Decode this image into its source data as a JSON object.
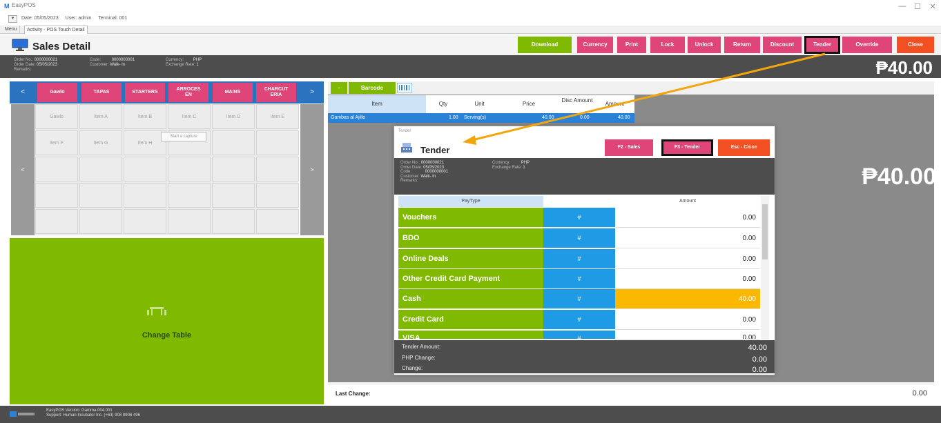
{
  "app": {
    "title": "EasyPOS",
    "logo_text": "M",
    "status": {
      "date": "Date: 05/05/2023",
      "user": "User: admin",
      "terminal": "Terminal: 001"
    },
    "window_controls": {
      "minimize": "—",
      "maximize": "☐",
      "close": "✕"
    }
  },
  "tabs": [
    {
      "label": "Menu"
    },
    {
      "label": "Activity - POS Touch Detail"
    }
  ],
  "header": {
    "title": "Sales Detail",
    "buttons": {
      "download": "Download",
      "currency": "Currency",
      "print": "Print",
      "lock": "Lock",
      "unlock": "Unlock",
      "return": "Return",
      "discount": "Discount",
      "tender": "Tender",
      "override": "Override",
      "close": "Close"
    }
  },
  "order_info": {
    "order_no_label": "Order No.:",
    "order_no": "0000000021",
    "order_date_label": "Order Date:",
    "order_date": "05/05/2023",
    "remarks_label": "Remarks:",
    "code_label": "Code:",
    "code": "0000000001",
    "customer_label": "Customer:",
    "customer": "Walk- In",
    "currency_label": "Currency:",
    "currency": "PHP",
    "exchange_rate_label": "Exchange Rate:",
    "exchange_rate": "1",
    "total": "₱40.00"
  },
  "categories": {
    "prev": "<",
    "next": ">",
    "items": [
      "Gawlo",
      "TAPAS",
      "STARTERS",
      "ARROCES EN",
      "MAINS",
      "CHARCUT ERIA"
    ]
  },
  "item_grid": {
    "left_arrow": "<",
    "right_arrow": ">",
    "row1": [
      "Gawlo",
      "Item A",
      "Item B",
      "Item C",
      "Item D",
      "Item E"
    ],
    "row2": [
      "Item F",
      "Item G",
      "Item H",
      "",
      "",
      ""
    ],
    "tooltip": "Start a capture"
  },
  "change_table": {
    "label": "Change Table"
  },
  "order_lines": {
    "minus": "-",
    "barcode_label": "Barcode",
    "columns": [
      "Item",
      "Qty",
      "Unit",
      "Price",
      "Disc Amount",
      "Amount"
    ],
    "rows": [
      {
        "item": "Gambas al Ajillo",
        "qty": "1.00",
        "unit": "Serving(s)",
        "price": "40.00",
        "disc": "0.00",
        "amount": "40.00"
      }
    ]
  },
  "tender_dialog": {
    "window_title": "Tender",
    "title": "Tender",
    "buttons": {
      "sales": "F2 - Sales",
      "tender": "F3 - Tender",
      "close": "Esc - Close"
    },
    "info": {
      "order_no_label": "Order No.:",
      "order_no": "0000000021",
      "order_date_label": "Order Date:",
      "order_date": "05/05/2023",
      "code_label": "Code:",
      "code": "0000000001",
      "customer_label": "Customer:",
      "customer": "Walk- In",
      "remarks_label": "Remarks:",
      "currency_label": "Currency:",
      "currency": "PHP",
      "exchange_rate_label": "Exchange Rate:",
      "exchange_rate": "1"
    },
    "total": "₱40.00",
    "pay_columns": [
      "PayType",
      "",
      "Amount"
    ],
    "pay_types": [
      {
        "name": "Vouchers",
        "hash": "#",
        "amount": "0.00"
      },
      {
        "name": "BDO",
        "hash": "#",
        "amount": "0.00"
      },
      {
        "name": "Online Deals",
        "hash": "#",
        "amount": "0.00"
      },
      {
        "name": "Other Credit Card Payment",
        "hash": "#",
        "amount": "0.00"
      },
      {
        "name": "Cash",
        "hash": "#",
        "amount": "40.00"
      },
      {
        "name": "Credit Card",
        "hash": "#",
        "amount": "0.00"
      },
      {
        "name": "VISA",
        "hash": "#",
        "amount": "0.00"
      }
    ],
    "summary": {
      "tender_amount_label": "Tender Amount:",
      "tender_amount": "40.00",
      "php_change_label": "PHP Change:",
      "php_change": "0.00",
      "change_label": "Change:",
      "change": "0.00"
    }
  },
  "last_change": {
    "label": "Last Change:",
    "value": "0.00"
  },
  "footer": {
    "logo_text": "EasyPOS",
    "version": "EasyPOS Version: Gamma.004.001",
    "support": "Support: Human Incubator Inc. (+63) 908 8906 496"
  },
  "colors": {
    "green": "#7fba00",
    "pink": "#e0457a",
    "orange": "#f25022",
    "blue": "#1e9be4",
    "yellow": "#fbb800",
    "dark": "#4d4d4d",
    "arrow": "#f2a60d"
  }
}
